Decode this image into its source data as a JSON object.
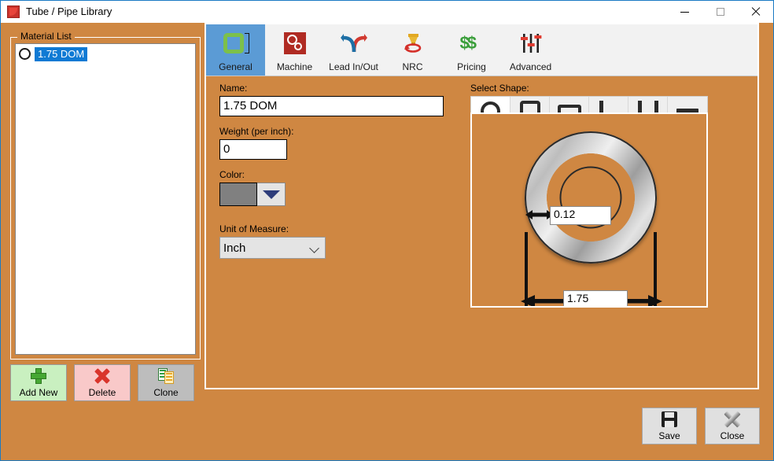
{
  "window": {
    "title": "Tube / Pipe Library",
    "app_icon": "tube-app-icon",
    "controls": {
      "minimize": "minimize-icon",
      "maximize": "maximize-icon",
      "close": "close-icon"
    }
  },
  "material_list": {
    "group_label": "Material List",
    "items": [
      {
        "label": "1.75 DOM",
        "shape_icon": "circle-tube-icon",
        "selected": true
      }
    ]
  },
  "list_buttons": [
    {
      "label": "Add New",
      "icon": "plus-icon"
    },
    {
      "label": "Delete",
      "icon": "x-icon"
    },
    {
      "label": "Clone",
      "icon": "copy-icon"
    }
  ],
  "tabs": [
    {
      "label": "General",
      "icon": "square-profile-icon",
      "selected": true
    },
    {
      "label": "Machine",
      "icon": "gears-icon",
      "selected": false
    },
    {
      "label": "Lead In/Out",
      "icon": "lead-arrows-icon",
      "selected": false
    },
    {
      "label": "NRC",
      "icon": "nozzle-icon",
      "selected": false
    },
    {
      "label": "Pricing",
      "icon": "dollar-signs-icon",
      "selected": false
    },
    {
      "label": "Advanced",
      "icon": "sliders-icon",
      "selected": false
    }
  ],
  "form": {
    "name_label": "Name:",
    "name_value": "1.75 DOM",
    "weight_label": "Weight (per inch):",
    "weight_value": "0",
    "color_label": "Color:",
    "color_value": "#808080",
    "uom_label": "Unit of Measure:",
    "uom_value": "Inch"
  },
  "shape": {
    "label": "Select Shape:",
    "options": [
      {
        "name": "round-tube",
        "icon": "circle-icon",
        "selected": true
      },
      {
        "name": "square-tube",
        "icon": "square-icon",
        "selected": false
      },
      {
        "name": "rect-tube",
        "icon": "rectangle-icon",
        "selected": false
      },
      {
        "name": "angle",
        "icon": "l-angle-icon",
        "selected": false
      },
      {
        "name": "channel",
        "icon": "u-channel-icon",
        "selected": false
      },
      {
        "name": "flat-bar",
        "icon": "flat-bar-icon",
        "selected": false
      }
    ],
    "preview": {
      "wall_thickness": "0.12",
      "outer_diameter": "1.75"
    }
  },
  "footer_buttons": [
    {
      "label": "Save",
      "icon": "floppy-icon"
    },
    {
      "label": "Close",
      "icon": "grey-x-icon"
    }
  ],
  "colors": {
    "background": "#cf8742",
    "selected_tab": "#5b9bd5",
    "selection_blue": "#0f7ad4"
  }
}
